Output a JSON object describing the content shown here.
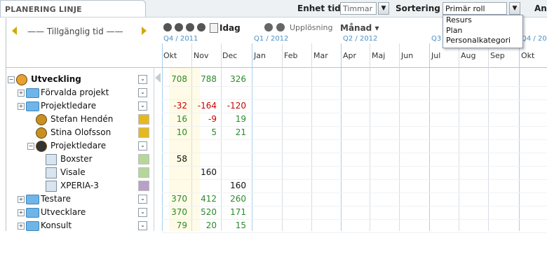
{
  "title": "PLANERING LINJE",
  "toolbar": {
    "unit_label": "Enhet tid",
    "unit_value": "Timmar",
    "sort_label": "Sortering",
    "sort_value": "Primär roll",
    "extra_label": "An",
    "sort_options": [
      "Resurs",
      "Plan",
      "Personalkategori"
    ]
  },
  "header": {
    "available_time": "Tillgänglig tid",
    "today_label": "Idag",
    "resolution_label": "Upplösning",
    "resolution_value": "Månad ▾",
    "quarters": [
      "Q4 / 2011",
      "Q1 / 2012",
      "Q2 / 2012",
      "Q3",
      "Q4 / 20"
    ],
    "months": [
      "Okt",
      "Nov",
      "Dec",
      "Jan",
      "Feb",
      "Mar",
      "Apr",
      "Maj",
      "Jun",
      "Jul",
      "Aug",
      "Sep",
      "Okt"
    ]
  },
  "rows": [
    {
      "label": "Utveckling",
      "bold": true,
      "indent": 0,
      "icon": "group-icon",
      "values": [
        "708",
        "788",
        "326"
      ],
      "value_colors": [
        "#2a8a2a",
        "#2a8a2a",
        "#2a8a2a"
      ],
      "has_expander": true
    },
    {
      "label": "Förvalda projekt",
      "bold": false,
      "indent": 1,
      "icon": "folder-icon",
      "values": [
        "",
        "",
        ""
      ],
      "value_colors": [
        "",
        "",
        ""
      ],
      "has_expander": true
    },
    {
      "label": "Projektledare",
      "bold": false,
      "indent": 1,
      "icon": "folder-icon",
      "values": [
        "-32",
        "-164",
        "-120"
      ],
      "value_colors": [
        "#cc0000",
        "#cc0000",
        "#cc0000"
      ],
      "has_expander": true
    },
    {
      "label": "Stefan Hendén",
      "bold": false,
      "indent": 2,
      "icon": "person-icon",
      "swatch": "#e6b820",
      "values": [
        "16",
        "-9",
        "19"
      ],
      "value_colors": [
        "#2a8a2a",
        "#cc0000",
        "#2a8a2a"
      ]
    },
    {
      "label": "Stina Olofsson",
      "bold": false,
      "indent": 2,
      "icon": "person-icon",
      "swatch": "#e6b820",
      "values": [
        "10",
        "5",
        "21"
      ],
      "value_colors": [
        "#2a8a2a",
        "#2a8a2a",
        "#2a8a2a"
      ]
    },
    {
      "label": "Projektledare",
      "bold": false,
      "indent": 2,
      "icon": "manager-icon",
      "values": [
        "",
        "",
        ""
      ],
      "value_colors": [
        "",
        "",
        ""
      ],
      "has_expander": true
    },
    {
      "label": "Boxster",
      "bold": false,
      "indent": 3,
      "icon": "project-icon",
      "swatch": "#b5d79a",
      "values": [
        "58",
        "",
        ""
      ],
      "value_colors": [
        "#111",
        "",
        ""
      ]
    },
    {
      "label": "Visale",
      "bold": false,
      "indent": 3,
      "icon": "project-icon",
      "swatch": "#b5d79a",
      "values": [
        "",
        "160",
        ""
      ],
      "value_colors": [
        "",
        "#111",
        ""
      ]
    },
    {
      "label": "XPERIA-3",
      "bold": false,
      "indent": 3,
      "icon": "project-icon",
      "swatch": "#b8a0c8",
      "values": [
        "",
        "",
        "160"
      ],
      "value_colors": [
        "",
        "",
        "#111"
      ]
    },
    {
      "label": "Testare",
      "bold": false,
      "indent": 1,
      "icon": "folder-icon",
      "values": [
        "370",
        "412",
        "260"
      ],
      "value_colors": [
        "#2a8a2a",
        "#2a8a2a",
        "#2a8a2a"
      ],
      "has_expander": true
    },
    {
      "label": "Utvecklare",
      "bold": false,
      "indent": 1,
      "icon": "folder-icon",
      "values": [
        "370",
        "520",
        "171"
      ],
      "value_colors": [
        "#2a8a2a",
        "#2a8a2a",
        "#2a8a2a"
      ],
      "has_expander": true
    },
    {
      "label": "Konsult",
      "bold": false,
      "indent": 1,
      "icon": "folder-icon",
      "values": [
        "79",
        "20",
        "15"
      ],
      "value_colors": [
        "#2a8a2a",
        "#2a8a2a",
        "#2a8a2a"
      ],
      "has_expander": true
    }
  ]
}
